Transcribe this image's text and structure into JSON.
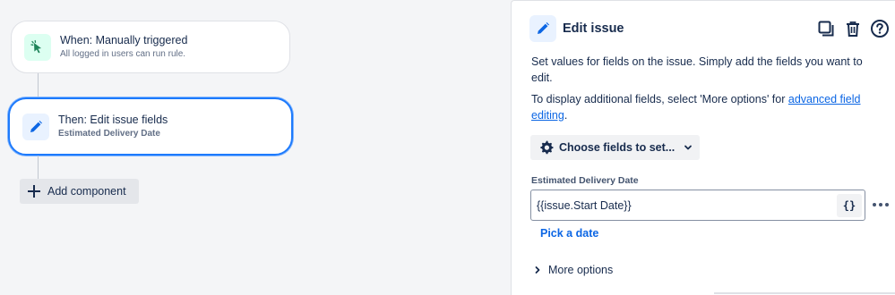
{
  "canvas": {
    "trigger": {
      "title": "When: Manually triggered",
      "subtitle": "All logged in users can run rule.",
      "icon": "cursor-click-icon"
    },
    "action": {
      "title": "Then: Edit issue fields",
      "subtitle": "Estimated Delivery Date",
      "icon": "pencil-icon"
    },
    "add_component_label": "Add component"
  },
  "panel": {
    "title": "Edit issue",
    "icons": [
      "duplicate-icon",
      "delete-icon",
      "help-icon"
    ],
    "description1": "Set values for fields on the issue. Simply add the fields you want to edit.",
    "description2_prefix": "To display additional fields, select 'More options' for ",
    "description2_link": "advanced field editing",
    "description2_suffix": ".",
    "choose_fields_label": "Choose fields to set...",
    "field": {
      "label": "Estimated Delivery Date",
      "value": "{{issue.Start Date}}",
      "smart_value_button": "{}",
      "pick_date_label": "Pick a date"
    },
    "more_options_label": "More options"
  },
  "colors": {
    "accent": "#0c66e4",
    "selected_border": "#1d7afc",
    "trigger_icon_bg": "#dcfff1",
    "action_icon_bg": "#e9f2ff"
  }
}
